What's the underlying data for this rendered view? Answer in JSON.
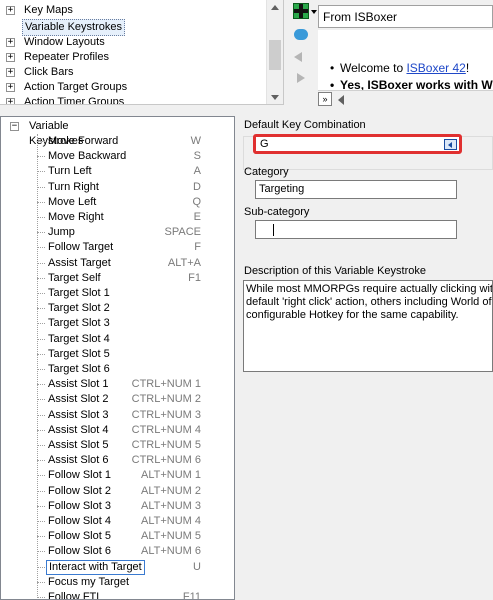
{
  "top_tree": {
    "items": [
      {
        "label": "Key Maps",
        "expander": "+"
      },
      {
        "label": "Variable Keystrokes",
        "expander": "",
        "selected": true
      },
      {
        "label": "Window Layouts",
        "expander": "+"
      },
      {
        "label": "Repeater Profiles",
        "expander": "+"
      },
      {
        "label": "Click Bars",
        "expander": "+"
      },
      {
        "label": "Action Target Groups",
        "expander": "+"
      },
      {
        "label": "Action Timer Groups",
        "expander": "+"
      }
    ]
  },
  "browser": {
    "address": "From ISBoxer",
    "bullets": {
      "welcome_prefix": "Welcome to ",
      "welcome_link": "ISBoxer 42",
      "welcome_suffix": "!",
      "works_with": "Yes, ISBoxer works with W"
    },
    "scroll_box": "»"
  },
  "main_tree": {
    "root": {
      "label": "Variable Keystrokes",
      "expander": "−"
    },
    "items": [
      {
        "label": "Move Forward",
        "hotkey": "W"
      },
      {
        "label": "Move Backward",
        "hotkey": "S"
      },
      {
        "label": "Turn Left",
        "hotkey": "A"
      },
      {
        "label": "Turn Right",
        "hotkey": "D"
      },
      {
        "label": "Move Left",
        "hotkey": "Q"
      },
      {
        "label": "Move Right",
        "hotkey": "E"
      },
      {
        "label": "Jump",
        "hotkey": "SPACE"
      },
      {
        "label": "Follow Target",
        "hotkey": "F"
      },
      {
        "label": "Assist Target",
        "hotkey": "ALT+A"
      },
      {
        "label": "Target Self",
        "hotkey": "F1"
      },
      {
        "label": "Target Slot 1",
        "hotkey": ""
      },
      {
        "label": "Target Slot 2",
        "hotkey": ""
      },
      {
        "label": "Target Slot 3",
        "hotkey": ""
      },
      {
        "label": "Target Slot 4",
        "hotkey": ""
      },
      {
        "label": "Target Slot 5",
        "hotkey": ""
      },
      {
        "label": "Target Slot 6",
        "hotkey": ""
      },
      {
        "label": "Assist Slot 1",
        "hotkey": "CTRL+NUM 1"
      },
      {
        "label": "Assist Slot 2",
        "hotkey": "CTRL+NUM 2"
      },
      {
        "label": "Assist Slot 3",
        "hotkey": "CTRL+NUM 3"
      },
      {
        "label": "Assist Slot 4",
        "hotkey": "CTRL+NUM 4"
      },
      {
        "label": "Assist Slot 5",
        "hotkey": "CTRL+NUM 5"
      },
      {
        "label": "Assist Slot 6",
        "hotkey": "CTRL+NUM 6"
      },
      {
        "label": "Follow Slot 1",
        "hotkey": "ALT+NUM 1"
      },
      {
        "label": "Follow Slot 2",
        "hotkey": "ALT+NUM 2"
      },
      {
        "label": "Follow Slot 3",
        "hotkey": "ALT+NUM 3"
      },
      {
        "label": "Follow Slot 4",
        "hotkey": "ALT+NUM 4"
      },
      {
        "label": "Follow Slot 5",
        "hotkey": "ALT+NUM 5"
      },
      {
        "label": "Follow Slot 6",
        "hotkey": "ALT+NUM 6"
      },
      {
        "label": "Interact with Target",
        "hotkey": "U",
        "selected": true
      },
      {
        "label": "Focus my Target",
        "hotkey": ""
      },
      {
        "label": "Follow FTL",
        "hotkey": "F11"
      }
    ]
  },
  "properties": {
    "default_key_label": "Default Key Combination",
    "default_key_value": "G",
    "category_label": "Category",
    "category_value": "Targeting",
    "subcategory_label": "Sub-category",
    "subcategory_value": "",
    "description_label": "Description of this Variable Keystroke",
    "description_lines": [
      "While most MMORPGs require actually clicking with the",
      "default 'right click' action, others including World of Wa",
      "configurable Hotkey for the same capability."
    ]
  },
  "colors": {
    "highlight_border": "#e03030",
    "link": "#1f48c8",
    "hotkey_text": "#7a7a7a"
  }
}
